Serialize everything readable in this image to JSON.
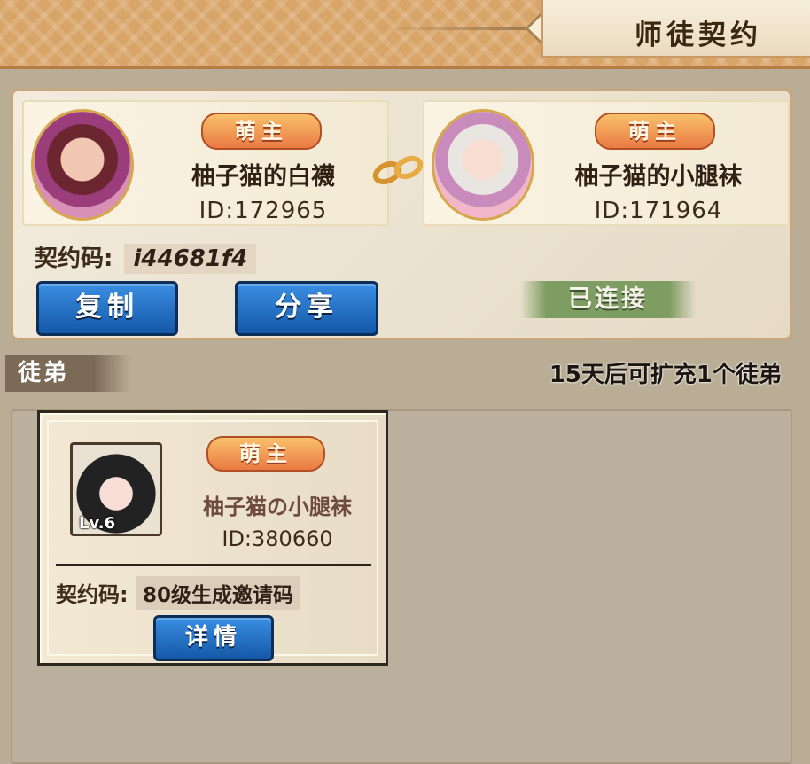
{
  "header": {
    "title": "师徒契约"
  },
  "master": {
    "left_card": {
      "badge": "萌主",
      "name": "柚子猫的白襪",
      "id": "ID:172965"
    },
    "right_card": {
      "badge": "萌主",
      "name": "柚子猫的小腿袜",
      "id": "ID:171964"
    },
    "code_label": "契约码:",
    "code_value": "i44681f4",
    "copy_label": "复制",
    "share_label": "分享",
    "status": "已连接"
  },
  "disciples": {
    "section_title": "徒弟",
    "expand_note": "15天后可扩充1个徒弟",
    "items": [
      {
        "badge": "萌主",
        "name": "柚子猫の小腿袜",
        "id": "ID:380660",
        "level": "Lv.6",
        "code_label": "契约码:",
        "code_value": "80级生成邀请码",
        "details_label": "详情"
      }
    ]
  }
}
